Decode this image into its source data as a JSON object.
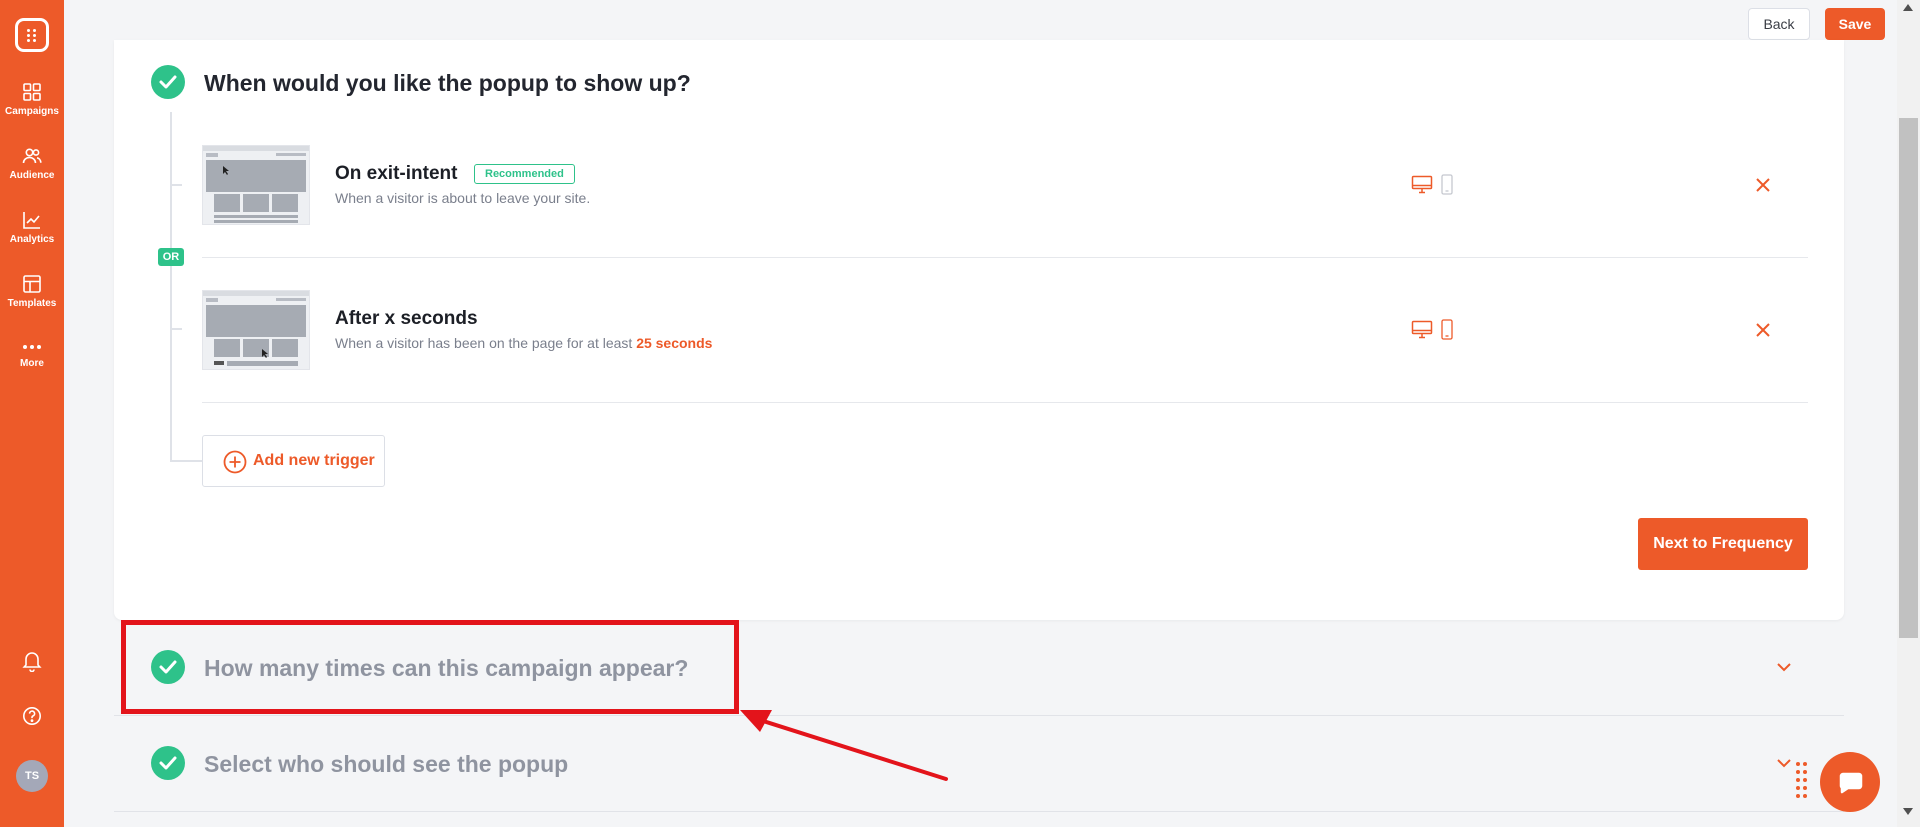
{
  "sidebar": {
    "items": [
      {
        "label": "Campaigns",
        "icon": "grid-icon"
      },
      {
        "label": "Audience",
        "icon": "users-icon"
      },
      {
        "label": "Analytics",
        "icon": "chart-icon"
      },
      {
        "label": "Templates",
        "icon": "layout-icon"
      },
      {
        "label": "More",
        "icon": "more-icon"
      }
    ],
    "avatar_initials": "TS"
  },
  "header": {
    "back_label": "Back",
    "save_label": "Save"
  },
  "trigger_section": {
    "title": "When would you like the popup to show up?",
    "or_label": "OR",
    "triggers": [
      {
        "title": "On exit-intent",
        "badge": "Recommended",
        "description": "When a visitor is about to leave your site.",
        "desktop": true,
        "mobile": false
      },
      {
        "title": "After x seconds",
        "description_prefix": "When a visitor has been on the page for at least",
        "description_value": "25 seconds",
        "desktop": true,
        "mobile": true
      }
    ],
    "add_trigger_label": "Add new trigger",
    "next_label": "Next to Frequency"
  },
  "frequency_section": {
    "title": "How many times can this campaign appear?"
  },
  "audience_section": {
    "title": "Select who should see the popup"
  },
  "colors": {
    "brand": "#ed5a29",
    "success": "#2ec28a",
    "highlight": "#e3141b"
  }
}
